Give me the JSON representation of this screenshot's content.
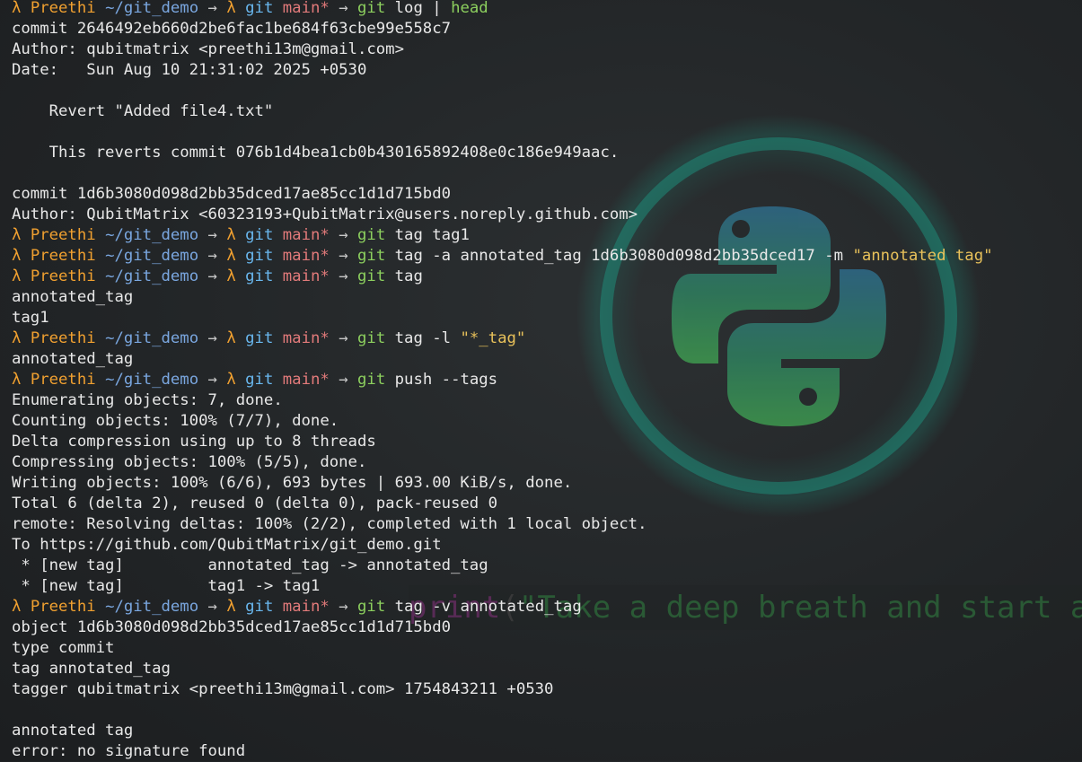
{
  "prompt": {
    "symbol": "λ",
    "user": "Preethi",
    "path": "~/git_demo",
    "arrow": "→",
    "git_label": "git",
    "branch": "main*",
    "command_word": "git"
  },
  "wallpaper": {
    "code_fn": "print",
    "code_paren": "(",
    "code_string": "\"Take a deep breath and start ag",
    "colors": {
      "logo_ring": "#1f8a78",
      "logo_blue": "#2f6b8a",
      "logo_green": "#3f9a4f"
    }
  },
  "lines": [
    {
      "type": "prompt",
      "args": "log | ",
      "extra": "head"
    },
    {
      "type": "output",
      "text": "commit 2646492eb660d2be6fac1be684f63cbe99e558c7"
    },
    {
      "type": "output",
      "text": "Author: qubitmatrix <preethi13m@gmail.com>"
    },
    {
      "type": "output",
      "text": "Date:   Sun Aug 10 21:31:02 2025 +0530"
    },
    {
      "type": "output",
      "text": ""
    },
    {
      "type": "output",
      "text": "    Revert \"Added file4.txt\""
    },
    {
      "type": "output",
      "text": ""
    },
    {
      "type": "output",
      "text": "    This reverts commit 076b1d4bea1cb0b430165892408e0c186e949aac."
    },
    {
      "type": "output",
      "text": ""
    },
    {
      "type": "output",
      "text": "commit 1d6b3080d098d2bb35dced17ae85cc1d1d715bd0"
    },
    {
      "type": "output",
      "text": "Author: QubitMatrix <60323193+QubitMatrix@users.noreply.github.com>"
    },
    {
      "type": "prompt",
      "args": "tag tag1"
    },
    {
      "type": "prompt",
      "args": "tag -a annotated_tag 1d6b3080d098d2bb35dced17 -m ",
      "str": "\"annotated tag\""
    },
    {
      "type": "prompt",
      "args": "tag"
    },
    {
      "type": "output",
      "text": "annotated_tag"
    },
    {
      "type": "output",
      "text": "tag1"
    },
    {
      "type": "prompt",
      "args": "tag -l ",
      "str": "\"*_tag\""
    },
    {
      "type": "output",
      "text": "annotated_tag"
    },
    {
      "type": "prompt",
      "args": "push --tags"
    },
    {
      "type": "output",
      "text": "Enumerating objects: 7, done."
    },
    {
      "type": "output",
      "text": "Counting objects: 100% (7/7), done."
    },
    {
      "type": "output",
      "text": "Delta compression using up to 8 threads"
    },
    {
      "type": "output",
      "text": "Compressing objects: 100% (5/5), done."
    },
    {
      "type": "output",
      "text": "Writing objects: 100% (6/6), 693 bytes | 693.00 KiB/s, done."
    },
    {
      "type": "output",
      "text": "Total 6 (delta 2), reused 0 (delta 0), pack-reused 0"
    },
    {
      "type": "output",
      "text": "remote: Resolving deltas: 100% (2/2), completed with 1 local object."
    },
    {
      "type": "output",
      "text": "To https://github.com/QubitMatrix/git_demo.git"
    },
    {
      "type": "output",
      "text": " * [new tag]         annotated_tag -> annotated_tag"
    },
    {
      "type": "output",
      "text": " * [new tag]         tag1 -> tag1"
    },
    {
      "type": "prompt",
      "args": "tag -v annotated_tag"
    },
    {
      "type": "output",
      "text": "object 1d6b3080d098d2bb35dced17ae85cc1d1d715bd0"
    },
    {
      "type": "output",
      "text": "type commit"
    },
    {
      "type": "output",
      "text": "tag annotated_tag"
    },
    {
      "type": "output",
      "text": "tagger qubitmatrix <preethi13m@gmail.com> 1754843211 +0530"
    },
    {
      "type": "output",
      "text": ""
    },
    {
      "type": "output",
      "text": "annotated tag"
    },
    {
      "type": "output",
      "text": "error: no signature found"
    }
  ]
}
